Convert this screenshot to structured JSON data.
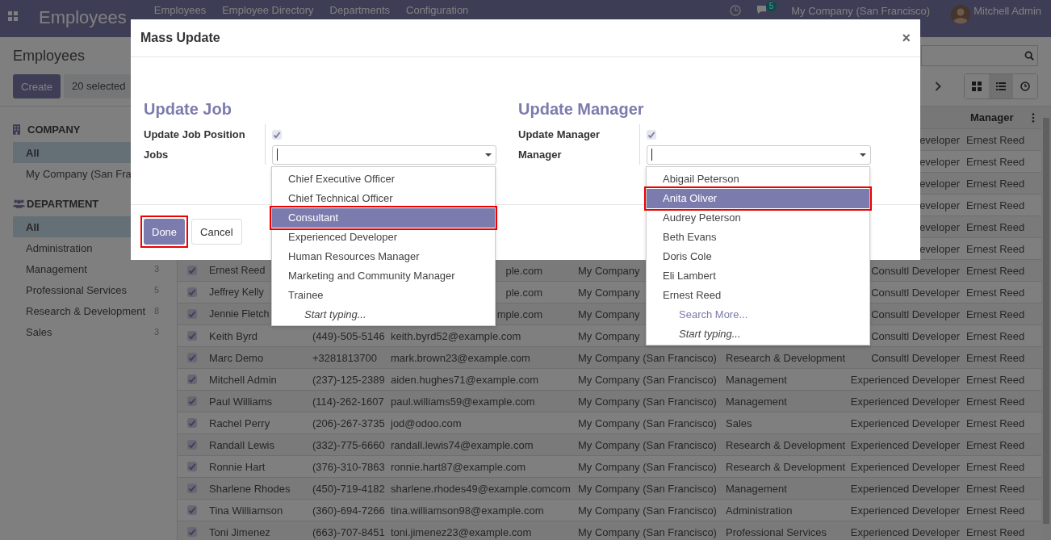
{
  "navbar": {
    "app_title": "Employees",
    "menu": [
      "Employees",
      "Employee Directory",
      "Departments",
      "Configuration"
    ],
    "chat_badge": "5",
    "company": "My Company (San Francisco)",
    "user": "Mitchell Admin"
  },
  "control_panel": {
    "breadcrumb": "Employees",
    "create": "Create",
    "selected_count": "20 selected"
  },
  "views": [
    {
      "kind": "kanban",
      "selected": false
    },
    {
      "kind": "list",
      "selected": true
    },
    {
      "kind": "activity",
      "selected": false
    }
  ],
  "sidebar": [
    {
      "kind": "company",
      "title": "COMPANY",
      "items": [
        {
          "label": "All",
          "selected": true
        },
        {
          "label": "My Company (San Fra",
          "selected": false
        }
      ]
    },
    {
      "kind": "department",
      "title": "DEPARTMENT",
      "items": [
        {
          "label": "All",
          "selected": true
        },
        {
          "label": "Administration",
          "selected": false
        },
        {
          "label": "Management",
          "count": "3",
          "selected": false
        },
        {
          "label": "Professional Services",
          "count": "5",
          "selected": false
        },
        {
          "label": "Research & Development",
          "count": "8",
          "selected": false
        },
        {
          "label": "Sales",
          "count": "3",
          "selected": false
        }
      ]
    }
  ],
  "table": {
    "columns": [
      "Manager"
    ],
    "rows": [
      {
        "kind": "edge",
        "job": "eveloper",
        "manager": "Ernest Reed"
      },
      {
        "kind": "edge",
        "job": "eveloper",
        "manager": "Ernest Reed"
      },
      {
        "kind": "edge",
        "job": "eveloper",
        "manager": "Ernest Reed"
      },
      {
        "kind": "edge",
        "job": "eveloper",
        "manager": "Ernest Reed"
      },
      {
        "kind": "edge",
        "job": "eveloper",
        "manager": "Ernest Reed"
      },
      {
        "kind": "edge",
        "job": "eveloper",
        "manager": "Ernest Reed"
      },
      {
        "kind": "covered",
        "checked": true,
        "name": "Ernest Reed",
        "email": "ple.com",
        "company": "My Company",
        "job": "Consultl Developer",
        "manager": "Ernest Reed"
      },
      {
        "kind": "covered",
        "checked": true,
        "name": "Jeffrey Kelly",
        "email": "ple.com",
        "company": "My Company",
        "job": "Consultl Developer",
        "manager": "Ernest Reed"
      },
      {
        "kind": "covered",
        "checked": true,
        "name": "Jennie Fletch",
        "email": "mple.com",
        "company": "My Company",
        "job": "Consultl Developer",
        "manager": "Ernest Reed"
      },
      {
        "kind": "full",
        "checked": true,
        "name": "Keith Byrd",
        "phone": "(449)-505-5146",
        "email": "keith.byrd52@example.com",
        "company": "My Company",
        "job": "Consultl Developer",
        "manager": "Ernest Reed"
      },
      {
        "kind": "full",
        "checked": true,
        "name": "Marc Demo",
        "phone": "+3281813700",
        "email": "mark.brown23@example.com",
        "company": "My Company (San Francisco)",
        "department": "Research & Development",
        "job": "Consultl Developer",
        "manager": "Ernest Reed"
      },
      {
        "kind": "full",
        "checked": true,
        "name": "Mitchell Admin",
        "phone": "(237)-125-2389",
        "email": "aiden.hughes71@example.com",
        "company": "My Company (San Francisco)",
        "department": "Management",
        "job": "Experienced Developer",
        "manager": "Ernest Reed"
      },
      {
        "kind": "full",
        "checked": true,
        "name": "Paul Williams",
        "phone": "(114)-262-1607",
        "email": "paul.williams59@example.com",
        "company": "My Company (San Francisco)",
        "department": "Management",
        "job": "Experienced Developer",
        "manager": "Ernest Reed"
      },
      {
        "kind": "full",
        "checked": true,
        "name": "Rachel Perry",
        "phone": "(206)-267-3735",
        "email": "jod@odoo.com",
        "company": "My Company (San Francisco)",
        "department": "Sales",
        "job": "Experienced Developer",
        "manager": "Ernest Reed"
      },
      {
        "kind": "full",
        "checked": true,
        "name": "Randall Lewis",
        "phone": "(332)-775-6660",
        "email": "randall.lewis74@example.com",
        "company": "My Company (San Francisco)",
        "department": "Research & Development",
        "job": "Experienced Developer",
        "manager": "Ernest Reed"
      },
      {
        "kind": "full",
        "checked": true,
        "name": "Ronnie Hart",
        "phone": "(376)-310-7863",
        "email": "ronnie.hart87@example.com",
        "company": "My Company (San Francisco)",
        "department": "Research & Development",
        "job": "Experienced Developer",
        "manager": "Ernest Reed"
      },
      {
        "kind": "full",
        "checked": true,
        "name": "Sharlene Rhodes",
        "phone": "(450)-719-4182",
        "email": "sharlene.rhodes49@example.comcom",
        "company": "My Company (San Francisco)",
        "department": "Management",
        "job": "Experienced Developer",
        "manager": "Ernest Reed"
      },
      {
        "kind": "full",
        "checked": true,
        "name": "Tina Williamson",
        "phone": "(360)-694-7266",
        "email": "tina.williamson98@example.com",
        "company": "My Company (San Francisco)",
        "department": "Administration",
        "job": "Experienced Developer",
        "manager": "Ernest Reed"
      },
      {
        "kind": "full",
        "checked": true,
        "name": "Toni Jimenez",
        "phone": "(663)-707-8451",
        "email": "toni.jimenez23@example.com",
        "company": "My Company (San Francisco)",
        "department": "Professional Services",
        "job": "Experienced Developer",
        "manager": "Ernest Reed"
      }
    ]
  },
  "modal": {
    "title": "Mass Update",
    "close": "×",
    "sections": [
      {
        "title": "Update Job",
        "toggle_label": "Update Job Position",
        "toggle_checked": true,
        "field_label": "Jobs",
        "options": [
          {
            "label": "Chief Executive Officer",
            "selected": false,
            "annotated": false
          },
          {
            "label": "Chief Technical Officer",
            "selected": false,
            "annotated": false
          },
          {
            "label": "Consultant",
            "selected": true,
            "annotated": true
          },
          {
            "label": "Experienced Developer",
            "selected": false,
            "annotated": false
          },
          {
            "label": "Human Resources Manager",
            "selected": false,
            "annotated": false
          },
          {
            "label": "Marketing and Community Manager",
            "selected": false,
            "annotated": false
          },
          {
            "label": "Trainee",
            "selected": false,
            "annotated": false
          }
        ],
        "hint": "Start typing..."
      },
      {
        "title": "Update Manager",
        "toggle_label": "Update Manager",
        "toggle_checked": true,
        "field_label": "Manager",
        "options": [
          {
            "label": "Abigail Peterson",
            "selected": false,
            "annotated": false
          },
          {
            "label": "Anita Oliver",
            "selected": true,
            "annotated": true
          },
          {
            "label": "Audrey Peterson",
            "selected": false,
            "annotated": false
          },
          {
            "label": "Beth Evans",
            "selected": false,
            "annotated": false
          },
          {
            "label": "Doris Cole",
            "selected": false,
            "annotated": false
          },
          {
            "label": "Eli Lambert",
            "selected": false,
            "annotated": false
          },
          {
            "label": "Ernest Reed",
            "selected": false,
            "annotated": false
          }
        ],
        "search_more": "Search More...",
        "hint": "Start typing..."
      }
    ],
    "buttons": [
      {
        "label": "Done",
        "kind": "primary",
        "annotated": true
      },
      {
        "label": "Cancel",
        "kind": "secondary"
      }
    ]
  }
}
